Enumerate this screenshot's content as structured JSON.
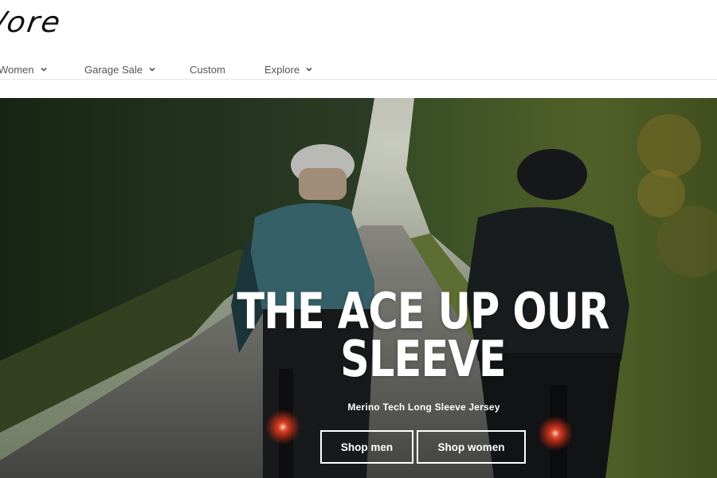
{
  "header": {
    "logo_text": "/ore",
    "nav": [
      {
        "label": "Women",
        "has_dropdown": true
      },
      {
        "label": "Garage Sale",
        "has_dropdown": true
      },
      {
        "label": "Custom",
        "has_dropdown": false
      },
      {
        "label": "Explore",
        "has_dropdown": true
      }
    ]
  },
  "hero": {
    "headline_line1": "THE ACE UP OUR",
    "headline_line2": "SLEEVE",
    "subtitle": "Merino Tech Long Sleeve Jersey",
    "buttons": {
      "men": "Shop men",
      "women": "Shop women"
    }
  },
  "colors": {
    "text_dark": "#111111",
    "nav_text": "#555555",
    "hero_text": "#ffffff"
  }
}
